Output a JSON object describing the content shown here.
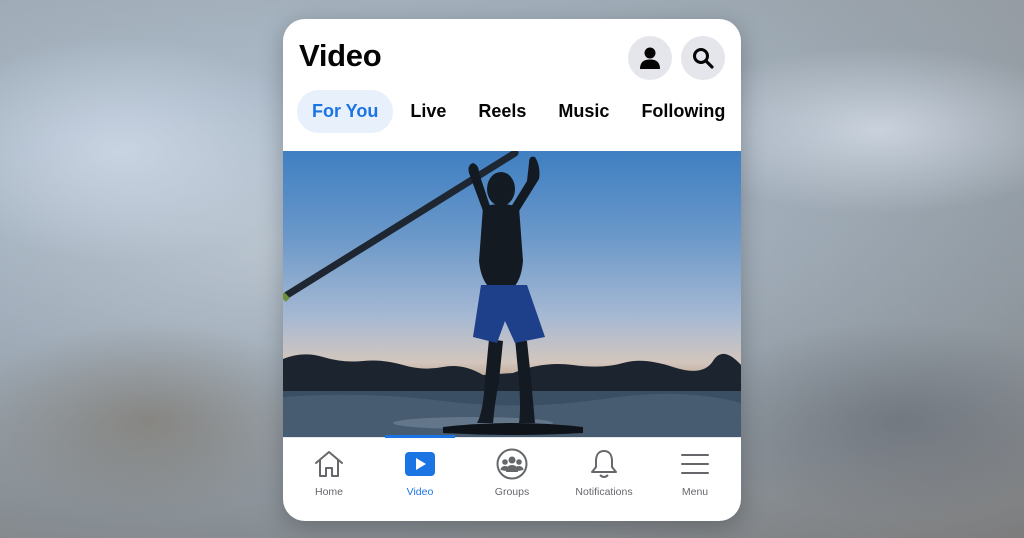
{
  "header": {
    "title": "Video"
  },
  "tabs": [
    {
      "label": "For You",
      "active": true
    },
    {
      "label": "Live",
      "active": false
    },
    {
      "label": "Reels",
      "active": false
    },
    {
      "label": "Music",
      "active": false
    },
    {
      "label": "Following",
      "active": false
    }
  ],
  "nav": [
    {
      "label": "Home",
      "icon": "home-icon",
      "active": false
    },
    {
      "label": "Video",
      "icon": "video-icon",
      "active": true
    },
    {
      "label": "Groups",
      "icon": "groups-icon",
      "active": false
    },
    {
      "label": "Notifications",
      "icon": "bell-icon",
      "active": false
    },
    {
      "label": "Menu",
      "icon": "menu-icon",
      "active": false
    }
  ],
  "colors": {
    "accent": "#1b74e4",
    "active_tab_bg": "#e7f0fb",
    "icon_bg": "#e4e6eb",
    "text": "#050505",
    "muted": "#65676b"
  }
}
